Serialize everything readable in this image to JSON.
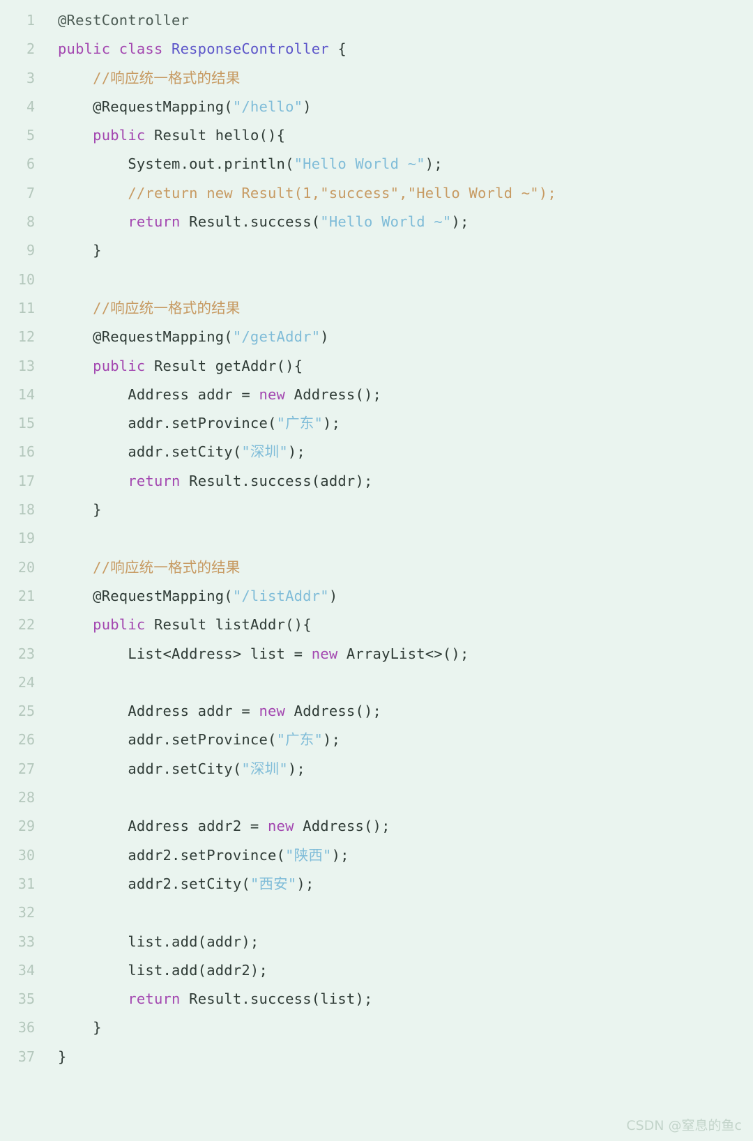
{
  "editor": {
    "background_color": "#eaf4ef",
    "line_number_color": "#b4c7bc",
    "language": "java",
    "total_lines": 37
  },
  "colors": {
    "keyword": "#a347b0",
    "type": "#5b54c9",
    "string": "#7fbcd8",
    "comment": "#c79a62",
    "plain": "#2f3b36",
    "annotation": "#4c5b54",
    "watermark": "#c3d4ca"
  },
  "watermark": {
    "text": "CSDN @窒息的鱼c"
  },
  "lines": [
    {
      "number": "1",
      "tokens": [
        {
          "t": "@RestController",
          "c": "anno"
        }
      ]
    },
    {
      "number": "2",
      "tokens": [
        {
          "t": "public class ",
          "c": "kw"
        },
        {
          "t": "ResponseController",
          "c": "type"
        },
        {
          "t": " {",
          "c": "plain"
        }
      ]
    },
    {
      "number": "3",
      "tokens": [
        {
          "t": "    //响应统一格式的结果",
          "c": "comment"
        }
      ]
    },
    {
      "number": "4",
      "tokens": [
        {
          "t": "    @RequestMapping(",
          "c": "plain"
        },
        {
          "t": "\"/hello\"",
          "c": "str"
        },
        {
          "t": ")",
          "c": "plain"
        }
      ]
    },
    {
      "number": "5",
      "tokens": [
        {
          "t": "    ",
          "c": "plain"
        },
        {
          "t": "public",
          "c": "kw"
        },
        {
          "t": " Result hello(){",
          "c": "plain"
        }
      ]
    },
    {
      "number": "6",
      "tokens": [
        {
          "t": "        System.out.println(",
          "c": "plain"
        },
        {
          "t": "\"Hello World ~\"",
          "c": "str"
        },
        {
          "t": ");",
          "c": "plain"
        }
      ]
    },
    {
      "number": "7",
      "tokens": [
        {
          "t": "        //return new Result(1,\"success\",\"Hello World ~\");",
          "c": "comment"
        }
      ]
    },
    {
      "number": "8",
      "tokens": [
        {
          "t": "        ",
          "c": "plain"
        },
        {
          "t": "return",
          "c": "kw"
        },
        {
          "t": " Result.success(",
          "c": "plain"
        },
        {
          "t": "\"Hello World ~\"",
          "c": "str"
        },
        {
          "t": ");",
          "c": "plain"
        }
      ]
    },
    {
      "number": "9",
      "tokens": [
        {
          "t": "    }",
          "c": "plain"
        }
      ]
    },
    {
      "number": "10",
      "tokens": [
        {
          "t": "",
          "c": "plain"
        }
      ]
    },
    {
      "number": "11",
      "tokens": [
        {
          "t": "    //响应统一格式的结果",
          "c": "comment"
        }
      ]
    },
    {
      "number": "12",
      "tokens": [
        {
          "t": "    @RequestMapping(",
          "c": "plain"
        },
        {
          "t": "\"/getAddr\"",
          "c": "str"
        },
        {
          "t": ")",
          "c": "plain"
        }
      ]
    },
    {
      "number": "13",
      "tokens": [
        {
          "t": "    ",
          "c": "plain"
        },
        {
          "t": "public",
          "c": "kw"
        },
        {
          "t": " Result getAddr(){",
          "c": "plain"
        }
      ]
    },
    {
      "number": "14",
      "tokens": [
        {
          "t": "        Address addr = ",
          "c": "plain"
        },
        {
          "t": "new",
          "c": "kw"
        },
        {
          "t": " Address();",
          "c": "plain"
        }
      ]
    },
    {
      "number": "15",
      "tokens": [
        {
          "t": "        addr.setProvince(",
          "c": "plain"
        },
        {
          "t": "\"广东\"",
          "c": "str"
        },
        {
          "t": ");",
          "c": "plain"
        }
      ]
    },
    {
      "number": "16",
      "tokens": [
        {
          "t": "        addr.setCity(",
          "c": "plain"
        },
        {
          "t": "\"深圳\"",
          "c": "str"
        },
        {
          "t": ");",
          "c": "plain"
        }
      ]
    },
    {
      "number": "17",
      "tokens": [
        {
          "t": "        ",
          "c": "plain"
        },
        {
          "t": "return",
          "c": "kw"
        },
        {
          "t": " Result.success(addr);",
          "c": "plain"
        }
      ]
    },
    {
      "number": "18",
      "tokens": [
        {
          "t": "    }",
          "c": "plain"
        }
      ]
    },
    {
      "number": "19",
      "tokens": [
        {
          "t": "",
          "c": "plain"
        }
      ]
    },
    {
      "number": "20",
      "tokens": [
        {
          "t": "    //响应统一格式的结果",
          "c": "comment"
        }
      ]
    },
    {
      "number": "21",
      "tokens": [
        {
          "t": "    @RequestMapping(",
          "c": "plain"
        },
        {
          "t": "\"/listAddr\"",
          "c": "str"
        },
        {
          "t": ")",
          "c": "plain"
        }
      ]
    },
    {
      "number": "22",
      "tokens": [
        {
          "t": "    ",
          "c": "plain"
        },
        {
          "t": "public",
          "c": "kw"
        },
        {
          "t": " Result listAddr(){",
          "c": "plain"
        }
      ]
    },
    {
      "number": "23",
      "tokens": [
        {
          "t": "        List<Address> list = ",
          "c": "plain"
        },
        {
          "t": "new",
          "c": "kw"
        },
        {
          "t": " ArrayList<>();",
          "c": "plain"
        }
      ]
    },
    {
      "number": "24",
      "tokens": [
        {
          "t": "",
          "c": "plain"
        }
      ]
    },
    {
      "number": "25",
      "tokens": [
        {
          "t": "        Address addr = ",
          "c": "plain"
        },
        {
          "t": "new",
          "c": "kw"
        },
        {
          "t": " Address();",
          "c": "plain"
        }
      ]
    },
    {
      "number": "26",
      "tokens": [
        {
          "t": "        addr.setProvince(",
          "c": "plain"
        },
        {
          "t": "\"广东\"",
          "c": "str"
        },
        {
          "t": ");",
          "c": "plain"
        }
      ]
    },
    {
      "number": "27",
      "tokens": [
        {
          "t": "        addr.setCity(",
          "c": "plain"
        },
        {
          "t": "\"深圳\"",
          "c": "str"
        },
        {
          "t": ");",
          "c": "plain"
        }
      ]
    },
    {
      "number": "28",
      "tokens": [
        {
          "t": "",
          "c": "plain"
        }
      ]
    },
    {
      "number": "29",
      "tokens": [
        {
          "t": "        Address addr2 = ",
          "c": "plain"
        },
        {
          "t": "new",
          "c": "kw"
        },
        {
          "t": " Address();",
          "c": "plain"
        }
      ]
    },
    {
      "number": "30",
      "tokens": [
        {
          "t": "        addr2.setProvince(",
          "c": "plain"
        },
        {
          "t": "\"陕西\"",
          "c": "str"
        },
        {
          "t": ");",
          "c": "plain"
        }
      ]
    },
    {
      "number": "31",
      "tokens": [
        {
          "t": "        addr2.setCity(",
          "c": "plain"
        },
        {
          "t": "\"西安\"",
          "c": "str"
        },
        {
          "t": ");",
          "c": "plain"
        }
      ]
    },
    {
      "number": "32",
      "tokens": [
        {
          "t": "",
          "c": "plain"
        }
      ]
    },
    {
      "number": "33",
      "tokens": [
        {
          "t": "        list.add(addr);",
          "c": "plain"
        }
      ]
    },
    {
      "number": "34",
      "tokens": [
        {
          "t": "        list.add(addr2);",
          "c": "plain"
        }
      ]
    },
    {
      "number": "35",
      "tokens": [
        {
          "t": "        ",
          "c": "plain"
        },
        {
          "t": "return",
          "c": "kw"
        },
        {
          "t": " Result.success(list);",
          "c": "plain"
        }
      ]
    },
    {
      "number": "36",
      "tokens": [
        {
          "t": "    }",
          "c": "plain"
        }
      ]
    },
    {
      "number": "37",
      "tokens": [
        {
          "t": "}",
          "c": "plain"
        }
      ]
    }
  ]
}
